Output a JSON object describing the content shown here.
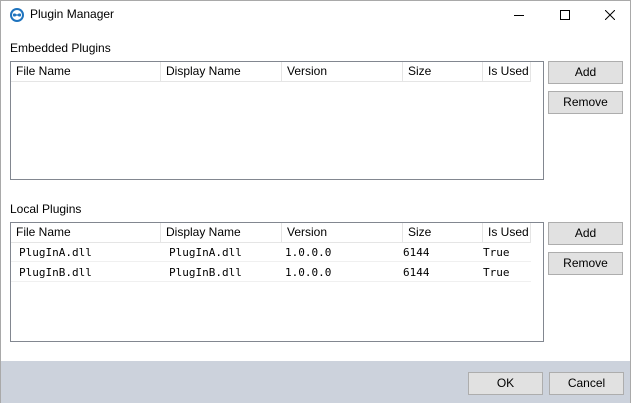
{
  "window": {
    "title": "Plugin Manager",
    "icon": "plugin-manager-app-icon",
    "controls": [
      "minimize-icon",
      "maximize-icon",
      "close-icon"
    ]
  },
  "embedded": {
    "label": "Embedded Plugins",
    "columns": [
      "File Name",
      "Display Name",
      "Version",
      "Size",
      "Is Used"
    ],
    "rows": [],
    "add_label": "Add",
    "remove_label": "Remove"
  },
  "local": {
    "label": "Local Plugins",
    "columns": [
      "File Name",
      "Display Name",
      "Version",
      "Size",
      "Is Used"
    ],
    "rows": [
      [
        "PlugInA.dll",
        "PlugInA.dll",
        "1.0.0.0",
        "6144",
        "True"
      ],
      [
        "PlugInB.dll",
        "PlugInB.dll",
        "1.0.0.0",
        "6144",
        "True"
      ]
    ],
    "add_label": "Add",
    "remove_label": "Remove"
  },
  "footer": {
    "ok_label": "OK",
    "cancel_label": "Cancel"
  },
  "colors": {
    "footer_bg": "#ccd2dc",
    "button_bg": "#e1e1e1",
    "list_border": "#828790"
  }
}
